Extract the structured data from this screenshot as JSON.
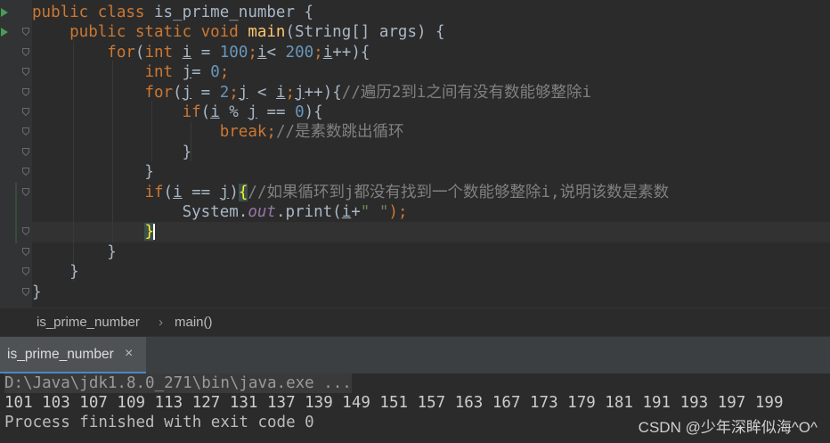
{
  "editor": {
    "lines": [
      {
        "parts": [
          {
            "t": "public class ",
            "c": "kw"
          },
          {
            "t": "is_prime_number {",
            "c": ""
          }
        ]
      },
      {
        "parts": [
          {
            "t": "    public static void ",
            "c": "kw"
          },
          {
            "t": "main",
            "c": "fn"
          },
          {
            "t": "(String[] args) {",
            "c": ""
          }
        ]
      },
      {
        "parts": [
          {
            "t": "        ",
            "c": ""
          },
          {
            "t": "for",
            "c": "kw"
          },
          {
            "t": "(",
            "c": ""
          },
          {
            "t": "int ",
            "c": "kw"
          },
          {
            "t": "i",
            "c": "u"
          },
          {
            "t": " = ",
            "c": ""
          },
          {
            "t": "100",
            "c": "num"
          },
          {
            "t": ";",
            "c": "kw"
          },
          {
            "t": "i",
            "c": "u"
          },
          {
            "t": "< ",
            "c": ""
          },
          {
            "t": "200",
            "c": "num"
          },
          {
            "t": ";",
            "c": "kw"
          },
          {
            "t": "i",
            "c": "u"
          },
          {
            "t": "++){",
            "c": ""
          }
        ]
      },
      {
        "parts": [
          {
            "t": "            ",
            "c": ""
          },
          {
            "t": "int ",
            "c": "kw"
          },
          {
            "t": "j",
            "c": "u"
          },
          {
            "t": "= ",
            "c": ""
          },
          {
            "t": "0",
            "c": "num"
          },
          {
            "t": ";",
            "c": "kw"
          }
        ]
      },
      {
        "parts": [
          {
            "t": "            ",
            "c": ""
          },
          {
            "t": "for",
            "c": "kw"
          },
          {
            "t": "(",
            "c": ""
          },
          {
            "t": "j",
            "c": "u"
          },
          {
            "t": " = ",
            "c": ""
          },
          {
            "t": "2",
            "c": "num"
          },
          {
            "t": ";",
            "c": "kw"
          },
          {
            "t": "j",
            "c": "u"
          },
          {
            "t": " < ",
            "c": ""
          },
          {
            "t": "i",
            "c": "u"
          },
          {
            "t": ";",
            "c": "kw"
          },
          {
            "t": "j",
            "c": "u"
          },
          {
            "t": "++){",
            "c": ""
          },
          {
            "t": "//遍历2到i之间有没有数能够整除i",
            "c": "cmt"
          }
        ]
      },
      {
        "parts": [
          {
            "t": "                ",
            "c": ""
          },
          {
            "t": "if",
            "c": "kw"
          },
          {
            "t": "(",
            "c": ""
          },
          {
            "t": "i",
            "c": "u"
          },
          {
            "t": " % ",
            "c": ""
          },
          {
            "t": "j",
            "c": "u"
          },
          {
            "t": " == ",
            "c": ""
          },
          {
            "t": "0",
            "c": "num"
          },
          {
            "t": "){",
            "c": ""
          }
        ]
      },
      {
        "parts": [
          {
            "t": "                    ",
            "c": ""
          },
          {
            "t": "break;",
            "c": "kw"
          },
          {
            "t": "//是素数跳出循环",
            "c": "cmt"
          }
        ]
      },
      {
        "parts": [
          {
            "t": "                }",
            "c": ""
          }
        ]
      },
      {
        "parts": [
          {
            "t": "            }",
            "c": ""
          }
        ]
      },
      {
        "parts": [
          {
            "t": "            ",
            "c": ""
          },
          {
            "t": "if",
            "c": "kw"
          },
          {
            "t": "(",
            "c": ""
          },
          {
            "t": "i",
            "c": "u"
          },
          {
            "t": " == ",
            "c": ""
          },
          {
            "t": "j",
            "c": "u"
          },
          {
            "t": ")",
            "c": ""
          },
          {
            "t": "{",
            "c": "brace-hl"
          },
          {
            "t": "//如果循环到j都没有找到一个数能够整除i,说明该数是素数",
            "c": "cmt"
          }
        ]
      },
      {
        "parts": [
          {
            "t": "                System.",
            "c": ""
          },
          {
            "t": "out",
            "c": "fld"
          },
          {
            "t": ".print(",
            "c": ""
          },
          {
            "t": "i",
            "c": "u"
          },
          {
            "t": "+",
            "c": ""
          },
          {
            "t": "\" \"",
            "c": "str"
          },
          {
            "t": ");",
            "c": "kw"
          }
        ]
      },
      {
        "parts": [
          {
            "t": "            ",
            "c": ""
          },
          {
            "t": "}",
            "c": "brace-hl"
          },
          {
            "t": "",
            "c": "caret"
          }
        ]
      },
      {
        "parts": [
          {
            "t": "        }",
            "c": ""
          }
        ]
      },
      {
        "parts": [
          {
            "t": "    }",
            "c": ""
          }
        ]
      },
      {
        "parts": [
          {
            "t": "}",
            "c": ""
          }
        ]
      }
    ]
  },
  "breadcrumb": {
    "class_name": "is_prime_number",
    "separator": "›",
    "method_name": "main()"
  },
  "run_panel": {
    "tab_label": "is_prime_number",
    "close_glyph": "×"
  },
  "console": {
    "command": "D:\\Java\\jdk1.8.0_271\\bin\\java.exe ...",
    "output": "101 103 107 109 113 127 131 137 139 149 151 157 163 167 173 179 181 191 193 197 199",
    "exit": "Process finished with exit code 0"
  },
  "watermark": "CSDN @少年深眸似海^O^"
}
